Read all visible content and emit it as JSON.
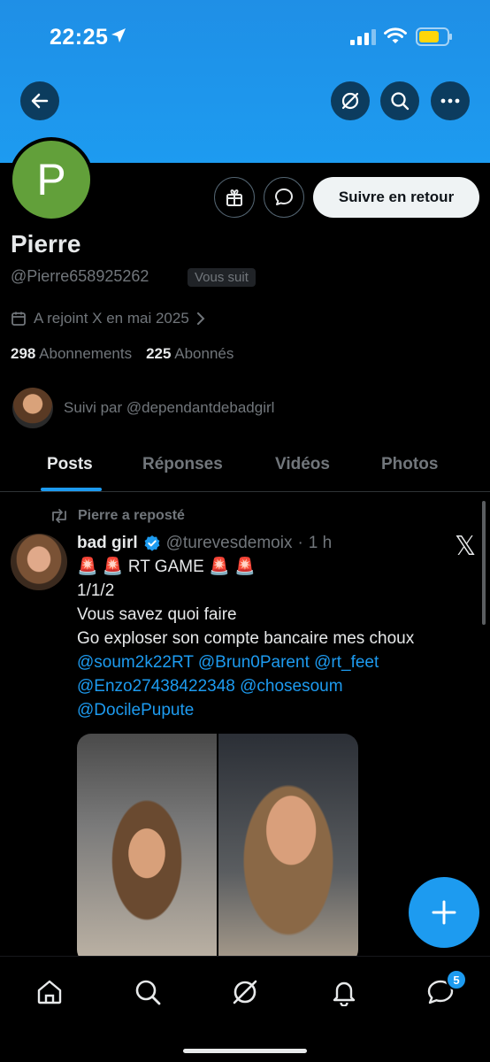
{
  "status_bar": {
    "time": "22:25"
  },
  "header": {
    "icons": [
      "back-arrow-icon",
      "grok-icon",
      "search-icon",
      "more-icon"
    ]
  },
  "profile": {
    "avatar_letter": "P",
    "name": "Pierre",
    "handle": "@Pierre658925262",
    "follows_you": "Vous suit",
    "joined": "A rejoint X en mai 2025",
    "following_count": "298",
    "following_label": "Abonnements",
    "followers_count": "225",
    "followers_label": "Abonnés",
    "followed_by": "Suivi par @dependantdebadgirl",
    "follow_back_label": "Suivre en retour"
  },
  "tabs": [
    {
      "label": "Posts",
      "active": true
    },
    {
      "label": "Réponses",
      "active": false
    },
    {
      "label": "Vidéos",
      "active": false
    },
    {
      "label": "Photos",
      "active": false
    }
  ],
  "post": {
    "repost_label": "Pierre a reposté",
    "author": "bad girl",
    "author_handle": "@turevesdemoix",
    "time": "1 h",
    "line1": "🚨 🚨 RT GAME 🚨 🚨",
    "line2": "1/1/2",
    "line3": "Vous savez quoi faire",
    "line4": "Go exploser son compte bancaire mes choux",
    "mentions": [
      "@soum2k22RT",
      "@Brun0Parent",
      "@rt_feet",
      "@Enzo27438422348",
      "@chosesoum",
      "@DocilePupute"
    ]
  },
  "bottom_nav": {
    "messages_badge": "5"
  },
  "colors": {
    "accent": "#1d9bf0",
    "banner": "#1d9bf0",
    "background": "#000000",
    "text_primary": "#e7e9ea",
    "text_secondary": "#71767b"
  }
}
